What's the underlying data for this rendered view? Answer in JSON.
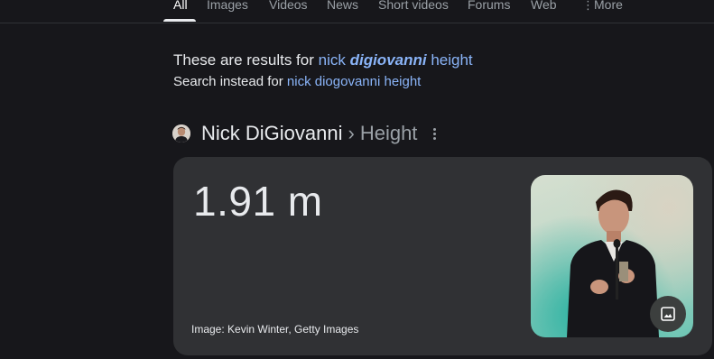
{
  "tabs": [
    {
      "label": "All",
      "active": true
    },
    {
      "label": "Images"
    },
    {
      "label": "Videos"
    },
    {
      "label": "News"
    },
    {
      "label": "Short videos"
    },
    {
      "label": "Forums"
    },
    {
      "label": "Web"
    },
    {
      "label": "More"
    }
  ],
  "correction": {
    "prefix": "These are results for ",
    "query_before": "nick ",
    "query_corrected": "digiovanni",
    "query_after": " height",
    "instead_prefix": "Search instead for ",
    "instead_query": "nick diogovanni height"
  },
  "entity": {
    "name": "Nick DiGiovanni",
    "separator": "›",
    "attribute": "Height"
  },
  "answer": {
    "value": "1.91 m",
    "credit": "Image: Kevin Winter, Getty Images"
  },
  "icons": {
    "more": "more-vert-icon",
    "options": "kebab-icon",
    "image": "image-icon"
  }
}
